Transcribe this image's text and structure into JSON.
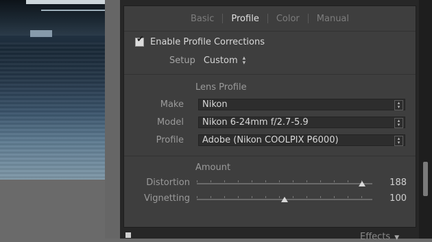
{
  "tabs": [
    {
      "label": "Basic",
      "active": false
    },
    {
      "label": "Profile",
      "active": true
    },
    {
      "label": "Color",
      "active": false
    },
    {
      "label": "Manual",
      "active": false
    }
  ],
  "enable_corrections": {
    "label": "Enable Profile Corrections",
    "checked": true
  },
  "setup": {
    "label": "Setup",
    "value": "Custom"
  },
  "lens_profile": {
    "title": "Lens Profile",
    "fields": [
      {
        "label": "Make",
        "value": "Nikon"
      },
      {
        "label": "Model",
        "value": "Nikon 6-24mm f/2.7-5.9"
      },
      {
        "label": "Profile",
        "value": "Adobe (Nikon COOLPIX P6000)"
      }
    ]
  },
  "amount": {
    "title": "Amount",
    "sliders": [
      {
        "label": "Distortion",
        "value": "188",
        "fraction": 0.94
      },
      {
        "label": "Vignetting",
        "value": "100",
        "fraction": 0.5
      }
    ]
  },
  "next_panel": {
    "label": "Effects"
  },
  "colors": {
    "panel_bg": "#3e3e3e",
    "outer_bg": "#272727",
    "active_tab": "#e0e0e0",
    "inactive_tab": "#7d7d7d"
  }
}
